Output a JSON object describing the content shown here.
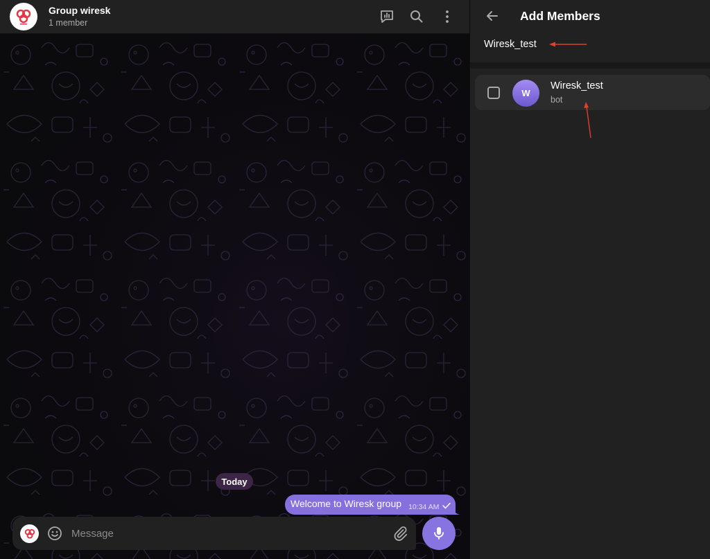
{
  "chat": {
    "title": "Group wiresk",
    "subtitle": "1 member",
    "date_chip": "Today",
    "messages": [
      {
        "text": "Welcome to Wiresk group",
        "time": "10:34 AM",
        "status": "sent"
      }
    ],
    "composer": {
      "placeholder": "Message"
    }
  },
  "header_icons": [
    "poll-icon",
    "search-icon",
    "more-vertical-icon"
  ],
  "add_members": {
    "title": "Add Members",
    "search_value": "Wiresk_test",
    "results": [
      {
        "initial": "W",
        "name": "Wiresk_test",
        "status": "bot",
        "checked": false
      }
    ]
  },
  "colors": {
    "accent": "#8774e1",
    "bubble": "#8670de",
    "panel": "#212121",
    "chat_bg": "#0b0a0d",
    "annotation_arrow": "#e0402a",
    "logo_red": "#e23744"
  }
}
